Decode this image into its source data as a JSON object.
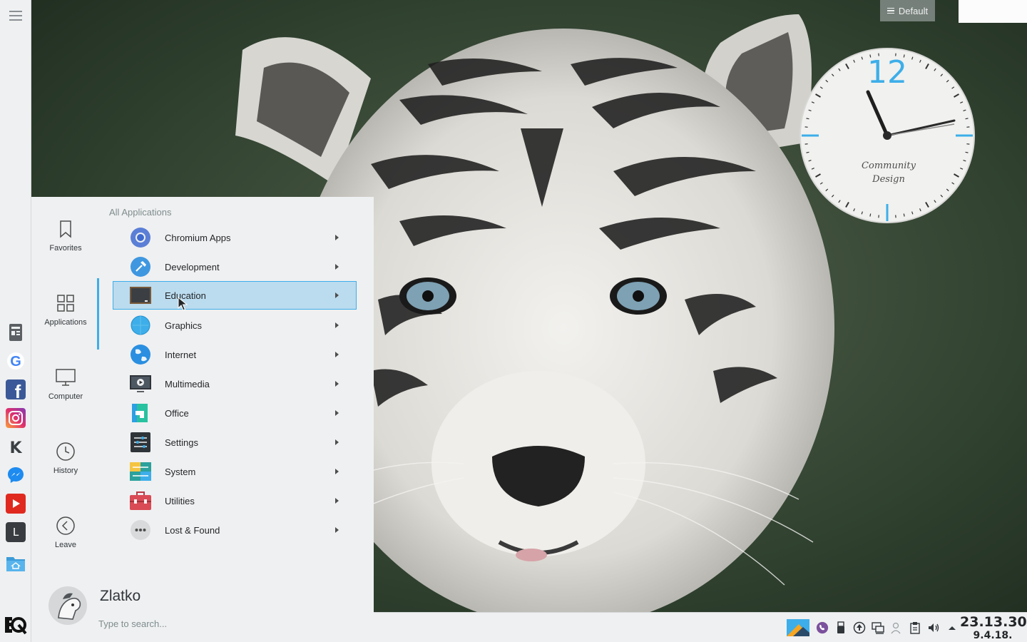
{
  "desktop": {
    "activity_label": "Default",
    "clock": {
      "numeral": "12",
      "brand_line1": "Community",
      "brand_line2": "Design",
      "hour_hand": "11",
      "minute_hand": "14"
    }
  },
  "launcher": {
    "section_title": "All Applications",
    "sidebar": [
      {
        "label": "Favorites",
        "icon": "bookmark-icon"
      },
      {
        "label": "Applications",
        "icon": "grid-icon"
      },
      {
        "label": "Computer",
        "icon": "monitor-icon"
      },
      {
        "label": "History",
        "icon": "clock-icon"
      },
      {
        "label": "Leave",
        "icon": "back-arrow-icon"
      }
    ],
    "categories": [
      {
        "label": "Chromium Apps",
        "icon": "chromium-icon"
      },
      {
        "label": "Development",
        "icon": "hammer-icon"
      },
      {
        "label": "Education",
        "icon": "chalkboard-icon",
        "selected": true
      },
      {
        "label": "Graphics",
        "icon": "graphics-icon"
      },
      {
        "label": "Internet",
        "icon": "globe-icon"
      },
      {
        "label": "Multimedia",
        "icon": "multimedia-icon"
      },
      {
        "label": "Office",
        "icon": "office-icon"
      },
      {
        "label": "Settings",
        "icon": "settings-icon"
      },
      {
        "label": "System",
        "icon": "system-icon"
      },
      {
        "label": "Utilities",
        "icon": "toolbox-icon"
      },
      {
        "label": "Lost & Found",
        "icon": "more-icon"
      }
    ],
    "user": {
      "name": "Zlatko"
    },
    "search": {
      "placeholder": "Type to search..."
    }
  },
  "taskbar": {
    "time": "23.13.30",
    "date": "9.4.18."
  },
  "left_panel": {
    "launchers": [
      "document-viewer-icon",
      "google-icon",
      "facebook-icon",
      "instagram-icon",
      "kde-icon",
      "messenger-icon",
      "youtube-icon",
      "libreoffice-icon",
      "home-folder-icon"
    ],
    "letter_l": "L",
    "letter_g": "G",
    "letter_f": "f",
    "letter_k": "K"
  },
  "colors": {
    "accent": "#3daee9",
    "panel": "#eff0f1",
    "selection": "#bbdbee"
  }
}
